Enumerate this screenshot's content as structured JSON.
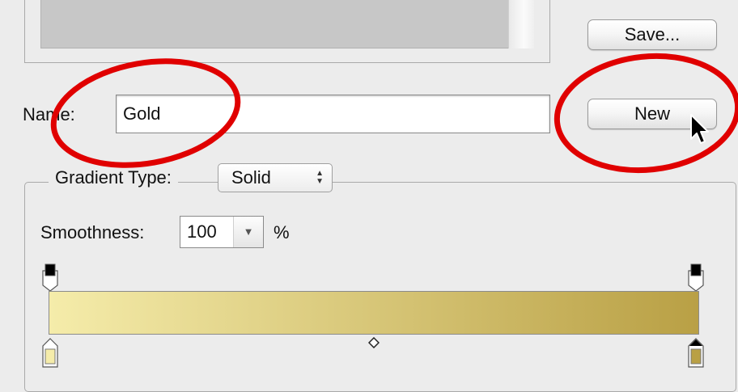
{
  "buttons": {
    "save_label": "Save...",
    "new_label": "New"
  },
  "name_row": {
    "label": "Name:",
    "value": "Gold"
  },
  "gradient_type": {
    "label": "Gradient Type:",
    "selected": "Solid"
  },
  "smoothness": {
    "label": "Smoothness:",
    "value": "100",
    "unit": "%"
  },
  "gradient": {
    "start_color": "#f5ecaa",
    "end_color": "#b9a045",
    "opacity_stops": [
      {
        "color": "#000000"
      },
      {
        "color": "#000000"
      }
    ],
    "color_stops": [
      {
        "color": "#f5ecaa"
      },
      {
        "color": "#b9a045"
      }
    ]
  },
  "annotation": {
    "color": "#e00000"
  }
}
